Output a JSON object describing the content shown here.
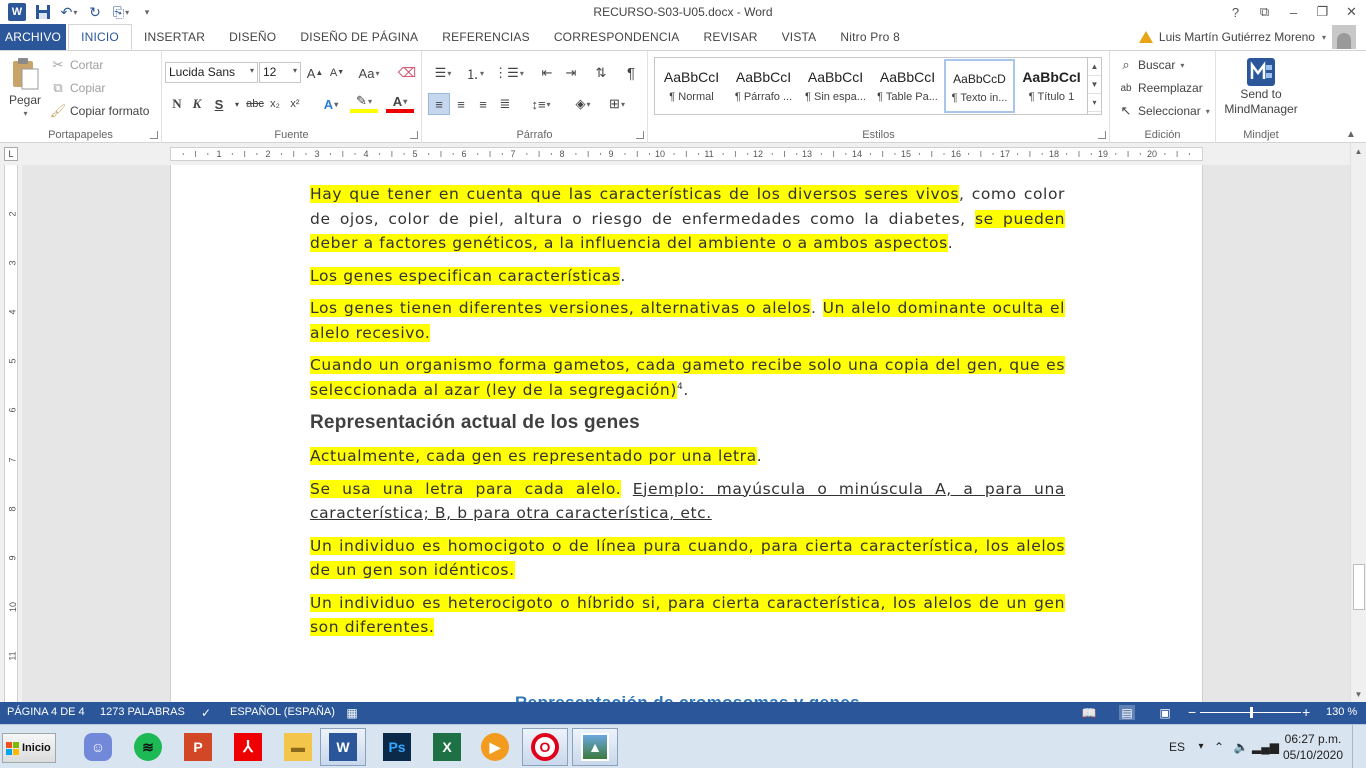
{
  "window": {
    "title": "RECURSO-S03-U05.docx - Word",
    "controls": {
      "help": "?",
      "restore_ribbon": "⧉",
      "minimize": "–",
      "maximize": "❐",
      "close": "✕"
    }
  },
  "tabs": [
    "ARCHIVO",
    "INICIO",
    "INSERTAR",
    "DISEÑO",
    "DISEÑO DE PÁGINA",
    "REFERENCIAS",
    "CORRESPONDENCIA",
    "REVISAR",
    "VISTA",
    "Nitro Pro 8"
  ],
  "active_tab": "INICIO",
  "user": {
    "name": "Luis Martín Gutiérrez Moreno"
  },
  "ribbon": {
    "clipboard": {
      "label": "Portapapeles",
      "paste": "Pegar",
      "cut": "Cortar",
      "copy": "Copiar",
      "format_painter": "Copiar formato"
    },
    "font": {
      "label": "Fuente",
      "family": "Lucida Sans",
      "size": "12",
      "bold": "N",
      "italic": "K",
      "underline": "S",
      "strike": "abc",
      "sub": "x₂",
      "sup": "x²"
    },
    "paragraph": {
      "label": "Párrafo"
    },
    "styles": {
      "label": "Estilos",
      "items": [
        {
          "preview": "AaBbCcI",
          "name": "¶ Normal"
        },
        {
          "preview": "AaBbCcI",
          "name": "¶ Párrafo ..."
        },
        {
          "preview": "AaBbCcI",
          "name": "¶ Sin espa..."
        },
        {
          "preview": "AaBbCcI",
          "name": "¶ Table Pa..."
        },
        {
          "preview": "AaBbCcD",
          "name": "¶ Texto in..."
        },
        {
          "preview": "AaBbCcI",
          "name": "¶ Título 1"
        }
      ],
      "selected_index": 4
    },
    "editing": {
      "label": "Edición",
      "find": "Buscar",
      "replace": "Reemplazar",
      "select": "Seleccionar"
    },
    "mindjet": {
      "label": "Mindjet",
      "send_line1": "Send to",
      "send_line2": "MindManager"
    }
  },
  "ruler": {
    "numbers": [
      "1",
      "2",
      "3",
      "4",
      "5",
      "6",
      "7",
      "8",
      "9",
      "10",
      "11",
      "12",
      "13",
      "14",
      "15",
      "16",
      "17",
      "18",
      "19",
      "20"
    ]
  },
  "vruler": {
    "numbers": [
      "2",
      "3",
      "4",
      "5",
      "6",
      "7",
      "8",
      "9",
      "10",
      "11"
    ]
  },
  "document": {
    "p1": {
      "a": "Hay que tener en cuenta que las características de los diversos seres vivos",
      "b": ", como color de ojos, color de piel, altura o riesgo de enfermedades  como la diabetes, ",
      "c": "se pueden deber a factores genéticos, a la influencia del ambiente  o a ambos aspectos",
      "d": "."
    },
    "p2": {
      "a": "Los genes especifican  características",
      "b": "."
    },
    "p3": {
      "a": "Los genes tienen diferentes versiones, alternativas o alelos",
      "b": ". ",
      "c": "Un alelo dominante oculta el alelo recesivo."
    },
    "p4": {
      "a": "Cuando un organismo forma gametos, cada gameto recibe solo una copia del gen, que es seleccionada al azar (ley de la segregación)",
      "sup": "4",
      "b": "."
    },
    "heading": "Representación actual de los genes",
    "p5": {
      "a": "Actualmente, cada gen es representado por una letra",
      "b": "."
    },
    "p6": {
      "a": "Se usa una letra para cada alelo.",
      "b": " ",
      "c": "Ejemplo: mayúscula o minúscula A, a para una característica; B, b para otra característica, etc."
    },
    "p7": {
      "a": "Un individuo es homocigoto o de línea pura cuando, para cierta característica, los alelos de un gen son idénticos."
    },
    "p8": {
      "a": "Un individuo es heterocigoto o híbrido si, para cierta característica, los alelos de un gen son diferentes."
    },
    "caption": "Representación de cromosomas y genes"
  },
  "status": {
    "page": "PÁGINA 4 DE 4",
    "words": "1273 PALABRAS",
    "language": "ESPAÑOL (ESPAÑA)",
    "zoom": "130 %",
    "zoom_minus": "−",
    "zoom_plus": "+"
  },
  "taskbar": {
    "start": "Inicio",
    "apps": [
      "discord-icon",
      "spotify-icon",
      "powerpoint-icon",
      "acrobat-icon",
      "explorer-icon",
      "word-icon",
      "photoshop-icon",
      "excel-icon",
      "media-player-icon",
      "opera-icon",
      "photos-icon"
    ],
    "lang": "ES",
    "time": "06:27 p.m.",
    "date": "05/10/2020"
  },
  "colors": {
    "word_blue": "#2b579a",
    "highlight": "#ffff00",
    "caption_blue": "#2e74b5"
  }
}
